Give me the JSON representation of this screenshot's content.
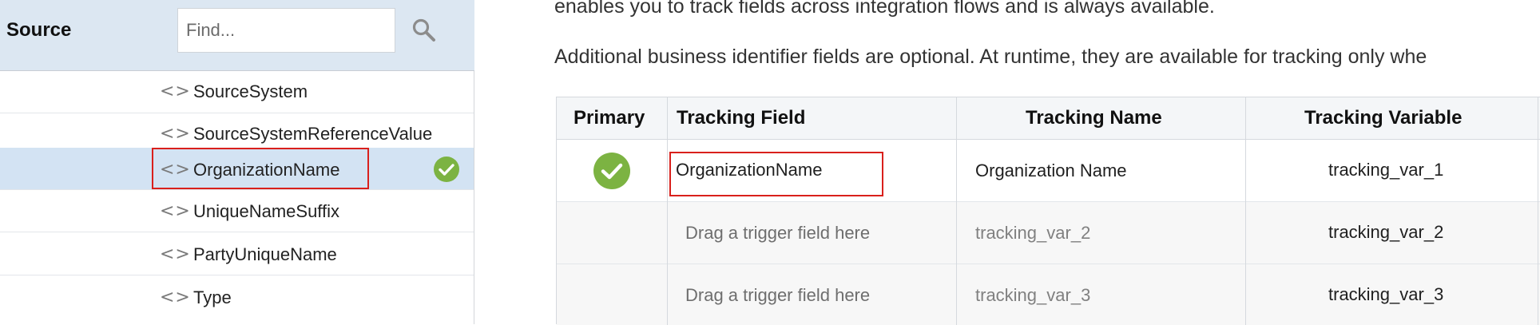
{
  "source_panel": {
    "title": "Source",
    "search_placeholder": "Find...",
    "items": [
      {
        "label": "SourceSystem",
        "selected": false
      },
      {
        "label": "SourceSystemReferenceValue",
        "selected": false
      },
      {
        "label": "OrganizationName",
        "selected": true,
        "tracked": true
      },
      {
        "label": "UniqueNameSuffix",
        "selected": false
      },
      {
        "label": "PartyUniqueName",
        "selected": false
      },
      {
        "label": "Type",
        "selected": false
      }
    ],
    "item_icon": "angle-brackets-icon"
  },
  "content": {
    "paragraph_1": "enables you to track fields across integration flows and is always available.",
    "paragraph_2": "Additional business identifier fields are optional. At runtime, they are available for tracking only whe"
  },
  "tracking_table": {
    "headers": [
      "Primary",
      "Tracking Field",
      "Tracking Name",
      "Tracking Variable"
    ],
    "rows": [
      {
        "primary": true,
        "field": "OrganizationName",
        "name": "Organization Name",
        "variable": "tracking_var_1"
      },
      {
        "primary": false,
        "field": "Drag a trigger field here",
        "name": "tracking_var_2",
        "variable": "tracking_var_2"
      },
      {
        "primary": false,
        "field": "Drag a trigger field here",
        "name": "tracking_var_3",
        "variable": "tracking_var_3"
      }
    ]
  },
  "colors": {
    "check_green": "#7cb342",
    "selection_blue": "#d3e3f3",
    "header_blue": "#dce7f2",
    "highlight_red": "#d9201c"
  }
}
